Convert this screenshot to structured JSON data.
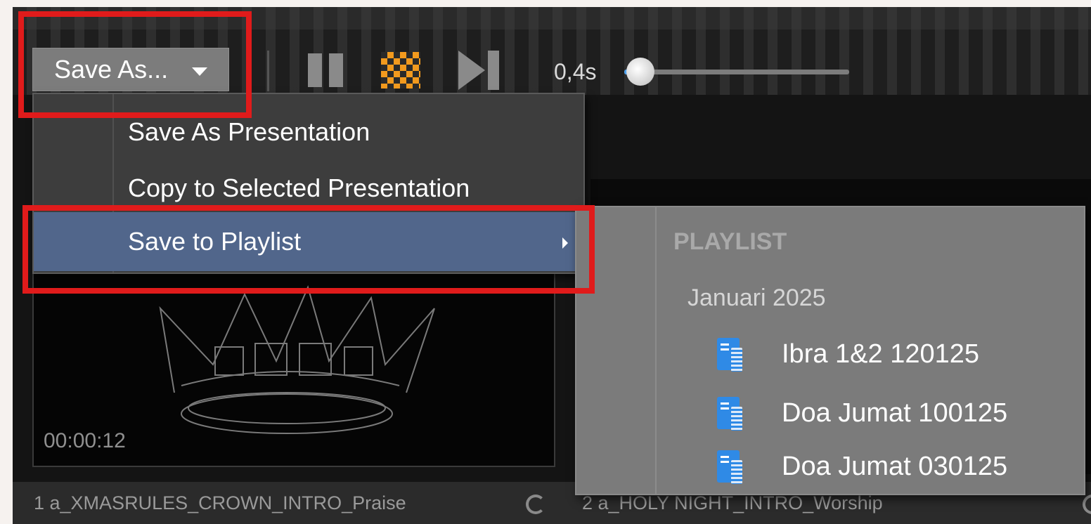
{
  "toolbar": {
    "save_as_label": "Save As...",
    "speed_label": "0,4s",
    "speed_value_fraction": 0.05,
    "icons": [
      "pause-icon",
      "checker-icon",
      "skip-to-end-icon"
    ]
  },
  "menu": {
    "items": [
      {
        "label": "Save As Presentation"
      },
      {
        "label": "Copy to Selected Presentation"
      },
      {
        "label": "Save to Playlist",
        "has_submenu": true,
        "highlighted": true
      }
    ]
  },
  "submenu": {
    "header": "PLAYLIST",
    "group": "Januari 2025",
    "items": [
      {
        "label": "Ibra 1&2 120125",
        "icon": "playlist-doc-icon"
      },
      {
        "label": "Doa Jumat 100125",
        "icon": "playlist-doc-icon"
      },
      {
        "label": "Doa Jumat 030125",
        "icon": "playlist-doc-icon"
      }
    ]
  },
  "media": {
    "timecode": "00:00:12",
    "captions": [
      {
        "label": "1 a_XMASRULES_CROWN_INTRO_Praise"
      },
      {
        "label": "2 a_HOLY NIGHT_INTRO_Worship"
      }
    ]
  },
  "colors": {
    "highlight_border": "#e01b1b",
    "menu_selected": "#51668b",
    "accent_blue": "#2f8ae6",
    "checker_orange": "#f29a1e"
  }
}
